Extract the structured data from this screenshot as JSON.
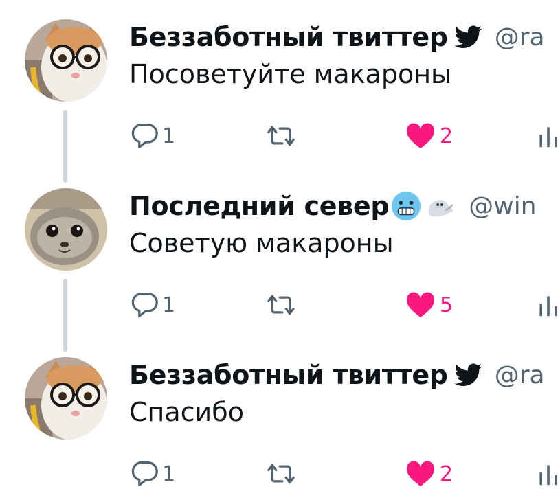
{
  "thread": [
    {
      "name": "Беззаботный твиттер",
      "handle": "@ra",
      "text": "Посоветуйте макароны",
      "reply_count": "1",
      "like_count": "2",
      "avatar": "cat-with-glasses",
      "badge": "twitter-bird-icon"
    },
    {
      "name": "Последний север",
      "handle": "@win",
      "text": "Советую макароны",
      "reply_count": "1",
      "like_count": "5",
      "avatar": "seal-pup",
      "badge": "cold-face-emoji, seal-emoji"
    },
    {
      "name": "Беззаботный твиттер",
      "handle": "@ra",
      "text": "Спасибо",
      "reply_count": "1",
      "like_count": "2",
      "avatar": "cat-with-glasses",
      "badge": "twitter-bird-icon"
    }
  ],
  "colors": {
    "like": "#f91880",
    "muted": "#536471",
    "thread_line": "#cfd9de",
    "text": "#0f1419"
  }
}
